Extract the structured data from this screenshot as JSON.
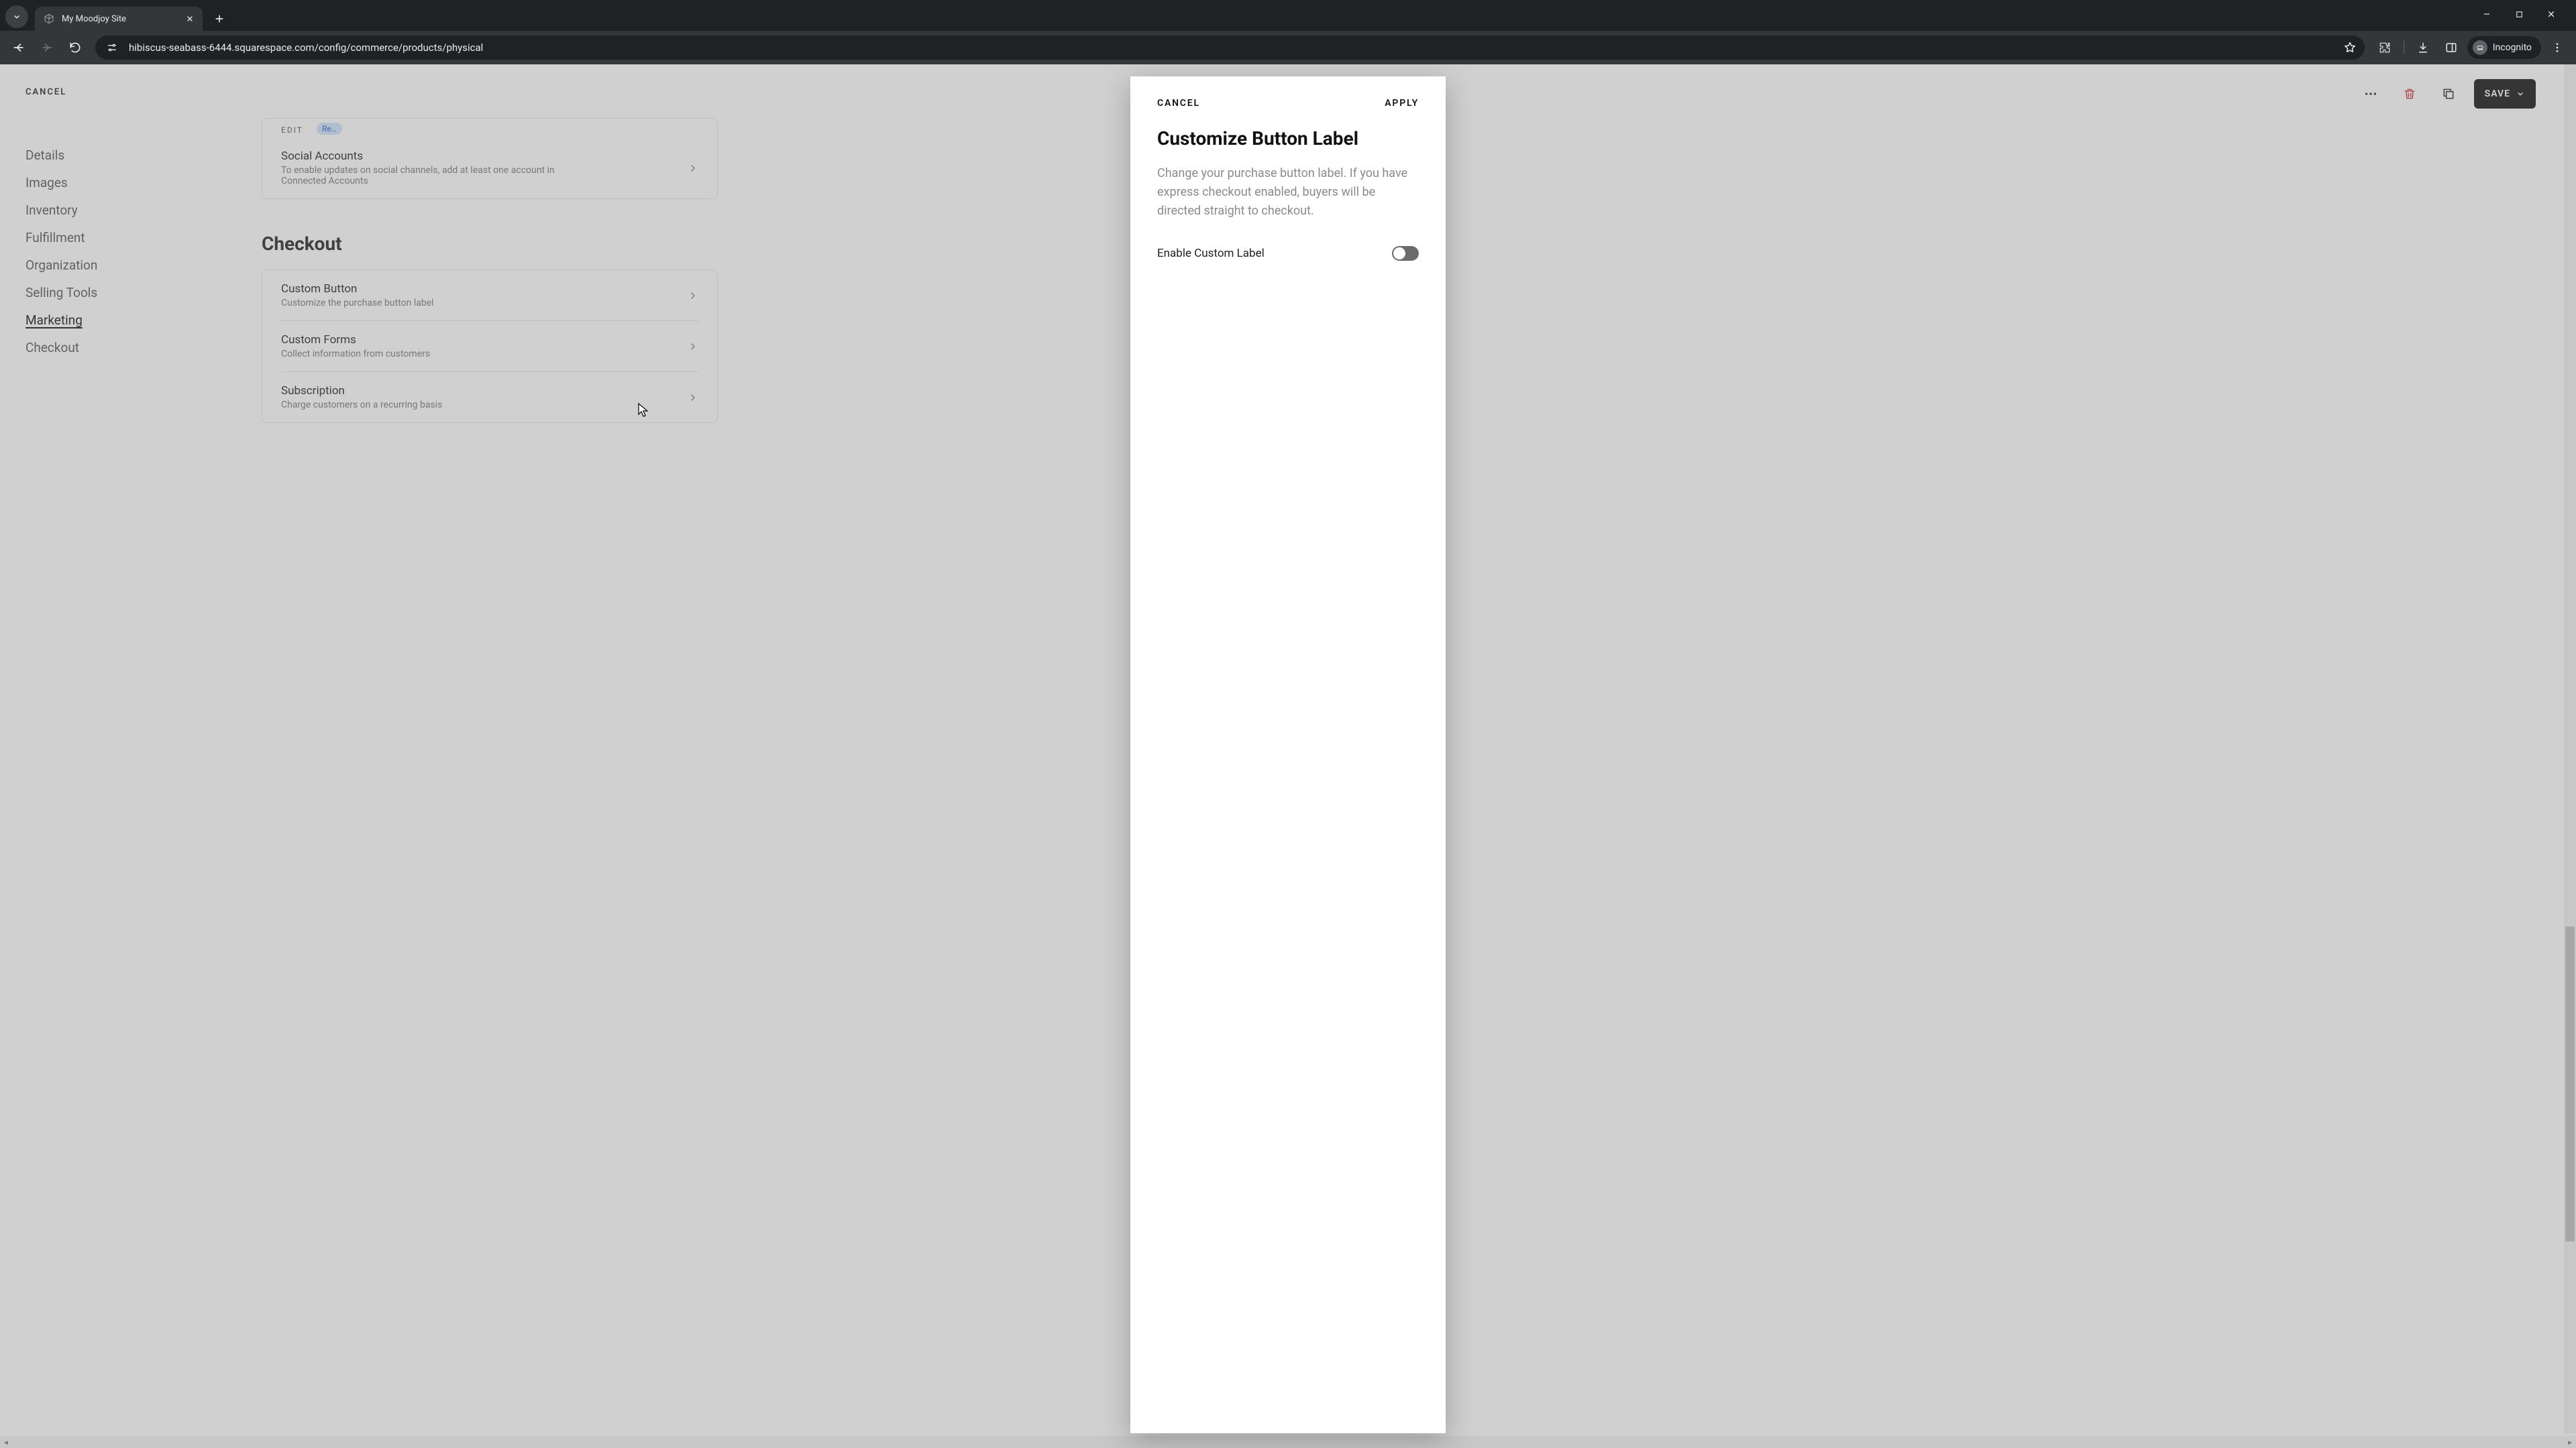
{
  "browser": {
    "tab_title": "My Moodjoy Site",
    "url": "hibiscus-seabass-6444.squarespace.com/config/commerce/products/physical",
    "incognito_label": "Incognito"
  },
  "page": {
    "cancel": "CANCEL",
    "sidebar": {
      "items": [
        {
          "label": "Details"
        },
        {
          "label": "Images"
        },
        {
          "label": "Inventory"
        },
        {
          "label": "Fulfillment"
        },
        {
          "label": "Organization"
        },
        {
          "label": "Selling Tools"
        },
        {
          "label": "Marketing"
        },
        {
          "label": "Checkout"
        }
      ],
      "active_index": 6
    },
    "save": "SAVE",
    "stub_edit": "EDIT",
    "stub_badge": "Re…",
    "social_row": {
      "title": "Social Accounts",
      "sub": "To enable updates on social channels, add at least one account in\nConnected Accounts"
    },
    "checkout_heading": "Checkout",
    "rows": [
      {
        "title": "Custom Button",
        "sub": "Customize the purchase button label"
      },
      {
        "title": "Custom Forms",
        "sub": "Collect information from customers"
      },
      {
        "title": "Subscription",
        "sub": "Charge customers on a recurring basis"
      }
    ]
  },
  "modal": {
    "cancel": "CANCEL",
    "apply": "APPLY",
    "title": "Customize Button Label",
    "description": "Change your purchase button label. If you have express checkout enabled, buyers will be directed straight to checkout.",
    "toggle_label": "Enable Custom Label",
    "toggle_on": false
  }
}
